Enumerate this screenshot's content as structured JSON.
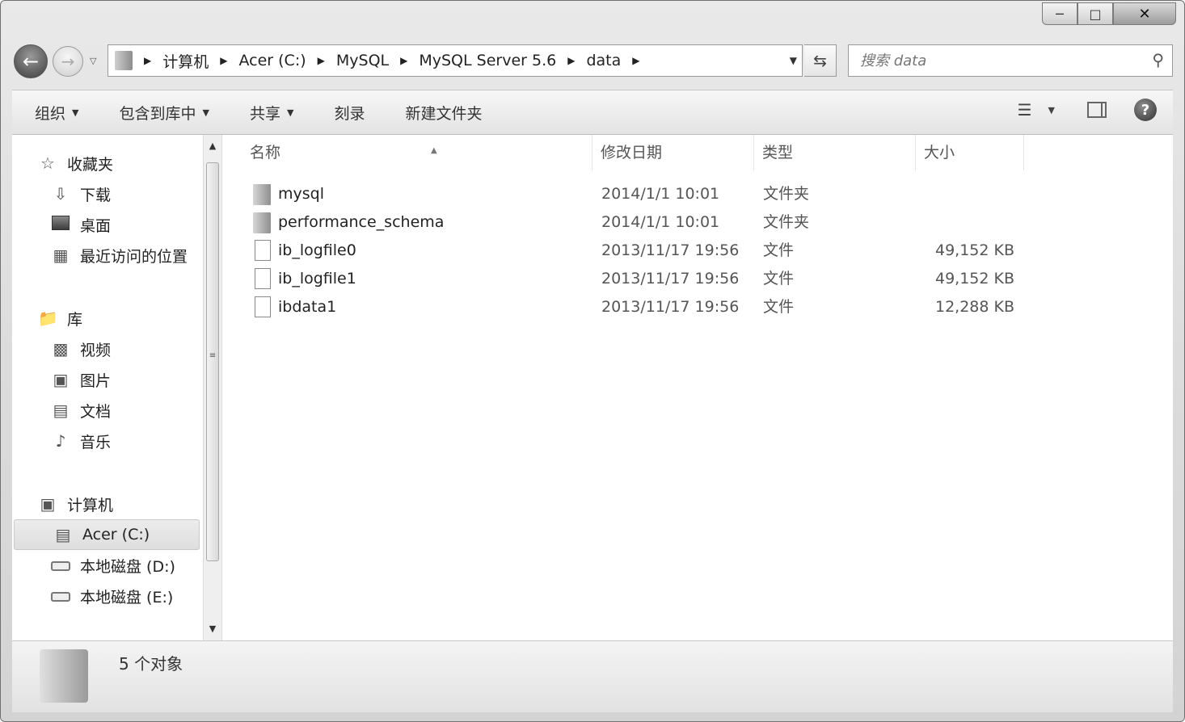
{
  "window": {
    "caption_buttons": [
      "minimize-icon",
      "maximize-icon",
      "close-icon"
    ]
  },
  "address": {
    "crumbs": [
      "计算机",
      "Acer (C:)",
      "MySQL",
      "MySQL Server 5.6",
      "data"
    ]
  },
  "search": {
    "placeholder": "搜索 data"
  },
  "toolbar": {
    "organize": "组织",
    "include_library": "包含到库中",
    "share": "共享",
    "burn": "刻录",
    "new_folder": "新建文件夹"
  },
  "nav": {
    "favorites": {
      "label": "收藏夹",
      "items": [
        "下载",
        "桌面",
        "最近访问的位置"
      ]
    },
    "libraries": {
      "label": "库",
      "items": [
        "视频",
        "图片",
        "文档",
        "音乐"
      ]
    },
    "computer": {
      "label": "计算机",
      "items": [
        "Acer (C:)",
        "本地磁盘 (D:)",
        "本地磁盘 (E:)"
      ],
      "selected": "Acer (C:)"
    }
  },
  "columns": {
    "name": "名称",
    "date": "修改日期",
    "type": "类型",
    "size": "大小"
  },
  "files": [
    {
      "name": "mysql",
      "date": "2014/1/1 10:01",
      "type": "文件夹",
      "size": "",
      "kind": "folder"
    },
    {
      "name": "performance_schema",
      "date": "2014/1/1 10:01",
      "type": "文件夹",
      "size": "",
      "kind": "folder"
    },
    {
      "name": "ib_logfile0",
      "date": "2013/11/17 19:56",
      "type": "文件",
      "size": "49,152 KB",
      "kind": "file"
    },
    {
      "name": "ib_logfile1",
      "date": "2013/11/17 19:56",
      "type": "文件",
      "size": "49,152 KB",
      "kind": "file"
    },
    {
      "name": "ibdata1",
      "date": "2013/11/17 19:56",
      "type": "文件",
      "size": "12,288 KB",
      "kind": "file"
    }
  ],
  "status": {
    "count_text": "5 个对象"
  }
}
